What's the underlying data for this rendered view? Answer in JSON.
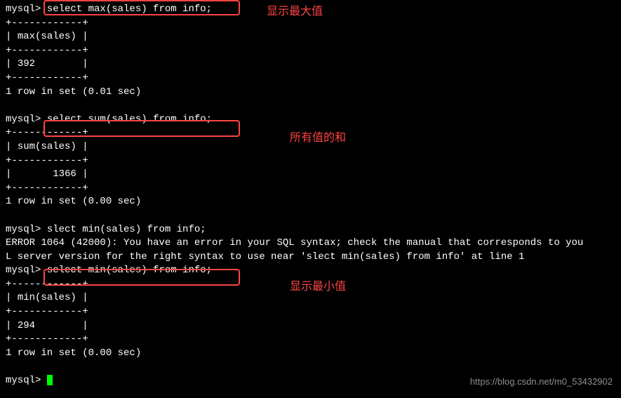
{
  "prompt": "mysql> ",
  "queries": {
    "max": {
      "cmd": "select max(sales) from info;",
      "col": "max(sales)",
      "value": "392",
      "timing": "1 row in set (0.01 sec)"
    },
    "sum": {
      "cmd": "select sum(sales) from info;",
      "col": "sum(sales)",
      "value": "      1366",
      "timing": "1 row in set (0.00 sec)"
    },
    "typo": {
      "cmd": "slect min(sales) from info;",
      "error_line1": "ERROR 1064 (42000): You have an error in your SQL syntax; check the manual that corresponds to you",
      "error_line2": "L server version for the right syntax to use near 'slect min(sales) from info' at line 1"
    },
    "min": {
      "cmd": "select min(sales) from info;",
      "col": "min(sales)",
      "value": "294",
      "timing": "1 row in set (0.00 sec)"
    }
  },
  "border": "+------------+",
  "annotations": {
    "max": "显示最大值",
    "sum": "所有值的和",
    "min": "显示最小值"
  },
  "watermark": "https://blog.csdn.net/m0_53432902"
}
